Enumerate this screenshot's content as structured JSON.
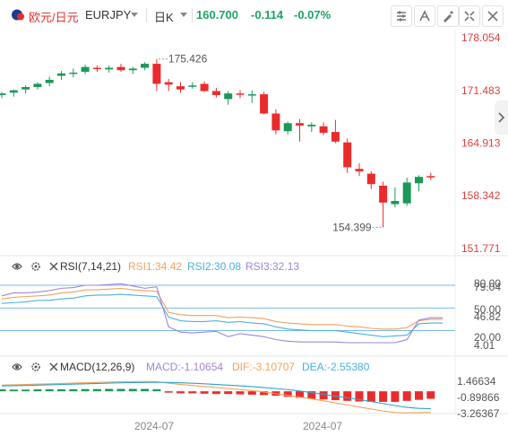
{
  "header": {
    "pair_name": "欧元/日元",
    "symbol": "EURJPY",
    "timeframe": "日K",
    "price": "160.700",
    "change": "-0.114",
    "change_pct": "-0.07%"
  },
  "icons": {
    "flag": "flag-icon",
    "symbol_dropdown": "chevron-down-icon",
    "timeframe_dropdown": "chevron-down-icon",
    "tools": [
      "chart-settings-icon",
      "indicator-icon",
      "drawing-tools-icon",
      "compare-icon",
      "fullscreen-icon",
      "close-icon"
    ],
    "side": "chevron-right-icon",
    "indicator_settings": [
      "eye-icon",
      "gear-icon",
      "close-icon"
    ]
  },
  "colors": {
    "up": "#1a9957",
    "down": "#eb2b2b",
    "price_axis": "#d94040",
    "rsi1": "#f5a15a",
    "rsi2": "#4ab3d8",
    "rsi3": "#9f86d4",
    "macd_line": "#2fa3c8",
    "signal_line": "#f5a15a",
    "header_change": "#1aa563"
  },
  "chart_data": [
    {
      "type": "candlestick",
      "price_axis_labels": [
        "178.054",
        "171.483",
        "164.913",
        "158.342",
        "151.771"
      ],
      "ylim": [
        151.771,
        178.054
      ],
      "annotations": [
        {
          "label": "175.426",
          "kind": "high"
        },
        {
          "label": "154.399",
          "kind": "low"
        }
      ],
      "candles": [
        {
          "o": 170.9,
          "h": 171.3,
          "l": 170.5,
          "c": 171.1
        },
        {
          "o": 171.2,
          "h": 171.6,
          "l": 170.7,
          "c": 171.5
        },
        {
          "o": 171.6,
          "h": 172.1,
          "l": 171.1,
          "c": 171.9
        },
        {
          "o": 171.9,
          "h": 172.5,
          "l": 171.6,
          "c": 172.3
        },
        {
          "o": 172.4,
          "h": 173.2,
          "l": 172.0,
          "c": 172.8
        },
        {
          "o": 173.3,
          "h": 173.9,
          "l": 172.8,
          "c": 173.6
        },
        {
          "o": 173.7,
          "h": 174.2,
          "l": 173.1,
          "c": 173.7
        },
        {
          "o": 173.8,
          "h": 174.7,
          "l": 173.5,
          "c": 174.4
        },
        {
          "o": 174.3,
          "h": 174.6,
          "l": 173.8,
          "c": 174.2
        },
        {
          "o": 174.1,
          "h": 174.6,
          "l": 173.7,
          "c": 174.3
        },
        {
          "o": 174.4,
          "h": 174.8,
          "l": 173.8,
          "c": 174.0
        },
        {
          "o": 174.0,
          "h": 174.4,
          "l": 173.5,
          "c": 174.2
        },
        {
          "o": 174.3,
          "h": 175.0,
          "l": 174.0,
          "c": 174.8
        },
        {
          "o": 174.8,
          "h": 175.4,
          "l": 171.4,
          "c": 172.3
        },
        {
          "o": 172.5,
          "h": 172.9,
          "l": 171.4,
          "c": 172.2
        },
        {
          "o": 172.0,
          "h": 172.5,
          "l": 171.2,
          "c": 171.6
        },
        {
          "o": 172.1,
          "h": 172.5,
          "l": 171.7,
          "c": 172.1
        },
        {
          "o": 172.3,
          "h": 172.6,
          "l": 171.3,
          "c": 171.4
        },
        {
          "o": 171.4,
          "h": 171.8,
          "l": 170.6,
          "c": 170.9
        },
        {
          "o": 170.4,
          "h": 171.4,
          "l": 169.7,
          "c": 171.1
        },
        {
          "o": 171.1,
          "h": 171.5,
          "l": 170.5,
          "c": 171.0
        },
        {
          "o": 170.9,
          "h": 171.5,
          "l": 169.9,
          "c": 171.0
        },
        {
          "o": 171.0,
          "h": 171.3,
          "l": 168.5,
          "c": 168.6
        },
        {
          "o": 168.6,
          "h": 169.1,
          "l": 166.0,
          "c": 166.5
        },
        {
          "o": 166.4,
          "h": 167.6,
          "l": 166.0,
          "c": 167.4
        },
        {
          "o": 167.4,
          "h": 167.9,
          "l": 165.1,
          "c": 167.1
        },
        {
          "o": 167.0,
          "h": 167.5,
          "l": 166.3,
          "c": 167.2
        },
        {
          "o": 167.0,
          "h": 167.5,
          "l": 165.9,
          "c": 166.2
        },
        {
          "o": 166.3,
          "h": 167.8,
          "l": 164.9,
          "c": 165.1
        },
        {
          "o": 165.0,
          "h": 165.5,
          "l": 161.2,
          "c": 161.9
        },
        {
          "o": 161.7,
          "h": 162.4,
          "l": 160.8,
          "c": 161.4
        },
        {
          "o": 161.1,
          "h": 161.4,
          "l": 159.2,
          "c": 159.8
        },
        {
          "o": 159.6,
          "h": 160.1,
          "l": 154.4,
          "c": 157.5
        },
        {
          "o": 157.3,
          "h": 159.4,
          "l": 156.9,
          "c": 157.7
        },
        {
          "o": 157.4,
          "h": 160.6,
          "l": 157.1,
          "c": 160.0
        },
        {
          "o": 159.9,
          "h": 160.9,
          "l": 158.9,
          "c": 160.7
        },
        {
          "o": 160.8,
          "h": 161.2,
          "l": 160.3,
          "c": 160.7
        }
      ]
    },
    {
      "type": "line",
      "name": "RSI(7,14,21)",
      "series_labels": [
        "RSI1:34.42",
        "RSI2:30.08",
        "RSI3:32.13"
      ],
      "axis_labels": [
        "80.00",
        "79.04",
        "50.00",
        "46.82",
        "20.00",
        "4.01"
      ],
      "levels": [
        80,
        50,
        20
      ],
      "ylim": [
        4.01,
        80
      ],
      "series": [
        {
          "values": [
            62,
            64,
            65,
            66,
            67,
            70,
            71,
            74,
            74,
            75,
            76,
            74,
            73,
            72,
            44,
            41,
            40,
            40,
            40,
            37,
            38,
            37,
            36,
            32,
            30,
            29,
            28,
            28,
            28,
            26,
            25,
            23,
            22,
            22,
            24,
            33,
            35,
            35
          ]
        },
        {
          "values": [
            56,
            57,
            58,
            60,
            60,
            62,
            63,
            66,
            67,
            67,
            68,
            67,
            66,
            65,
            38,
            33,
            32,
            32,
            33,
            31,
            32,
            30,
            29,
            25,
            22,
            21,
            20,
            20,
            20,
            18,
            16,
            14,
            12,
            13,
            14,
            29,
            30,
            30
          ]
        },
        {
          "values": [
            66,
            70,
            70,
            71,
            73,
            76,
            77,
            80,
            80,
            81,
            82,
            79,
            76,
            78,
            25,
            18,
            17,
            18,
            19,
            12,
            16,
            14,
            12,
            8,
            6,
            5,
            5,
            5,
            5,
            4,
            4,
            4,
            4,
            4,
            8,
            34,
            37,
            37
          ]
        }
      ]
    },
    {
      "type": "bar",
      "name": "MACD(12,26,9)",
      "series_labels": [
        "MACD:-1.10654",
        "DIF:-3.10707",
        "DEA:-2.55380"
      ],
      "axis_labels": [
        "1.46634",
        "-0.89866",
        "-3.26367"
      ],
      "ylim": [
        -3.26367,
        1.46634
      ],
      "histogram": [
        0.3,
        0.25,
        0.25,
        0.28,
        0.3,
        0.3,
        0.3,
        0.32,
        0.32,
        0.35,
        0.35,
        0.35,
        0.35,
        0.3,
        -0.2,
        -0.3,
        -0.3,
        -0.35,
        -0.4,
        -0.4,
        -0.45,
        -0.5,
        -0.55,
        -0.65,
        -0.8,
        -0.95,
        -1.1,
        -1.2,
        -1.3,
        -1.4,
        -1.5,
        -1.55,
        -1.55,
        -1.55,
        -1.4,
        -1.25,
        -1.1
      ],
      "series": [
        {
          "values": [
            0.9,
            0.95,
            1.0,
            1.05,
            1.1,
            1.15,
            1.2,
            1.25,
            1.3,
            1.35,
            1.4,
            1.4,
            1.45,
            1.4,
            1.2,
            1.0,
            0.85,
            0.7,
            0.55,
            0.4,
            0.25,
            0.1,
            -0.1,
            -0.35,
            -0.6,
            -0.85,
            -1.1,
            -1.4,
            -1.7,
            -2.0,
            -2.3,
            -2.6,
            -2.9,
            -3.1,
            -3.15,
            -3.12,
            -3.11
          ]
        },
        {
          "values": [
            0.8,
            0.82,
            0.85,
            0.9,
            0.95,
            1.0,
            1.05,
            1.1,
            1.15,
            1.2,
            1.25,
            1.28,
            1.3,
            1.32,
            1.3,
            1.25,
            1.18,
            1.1,
            1.0,
            0.9,
            0.8,
            0.68,
            0.55,
            0.4,
            0.25,
            0.05,
            -0.2,
            -0.45,
            -0.7,
            -0.95,
            -1.2,
            -1.5,
            -1.8,
            -2.1,
            -2.35,
            -2.5,
            -2.55
          ]
        }
      ]
    }
  ],
  "x_axis": {
    "labels": [
      "2024-07",
      "2024-07"
    ]
  }
}
